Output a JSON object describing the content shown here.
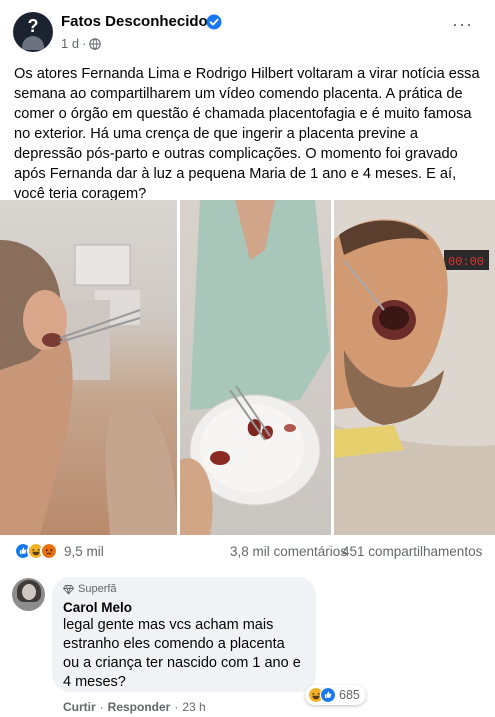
{
  "post": {
    "page_name": "Fatos Desconhecidos",
    "time": "1 d",
    "dot": "·",
    "more_label": "···",
    "caption": "Os atores Fernanda Lima e Rodrigo Hilbert voltaram a virar notícia essa semana ao compartilharem um vídeo comendo placenta. A prática de comer o órgão em questão é chamada placentofagia e é muito famosa no exterior. Há uma crença de que ingerir a placenta previne a depressão pós-parto e outras complicações. O momento foi gravado após Fernanda dar à luz a pequena Maria de 1 ano e 4 meses. E aí, você teria coragem?",
    "icons": {
      "verified": "verified-badge-icon",
      "audience": "globe-icon",
      "more": "more-options-icon"
    }
  },
  "stats": {
    "reactions_count": "9,5 mil",
    "comments": "3,8 mil comentários",
    "shares": "451 compartilhamentos",
    "reaction_types": [
      "like",
      "haha",
      "wow"
    ]
  },
  "comment": {
    "badge": "Superfã",
    "author": "Carol Melo",
    "text": "legal gente mas vcs acham mais estranho eles comendo a placenta ou a criança ter nascido com 1 ano e 4 meses?",
    "reaction_count": "685",
    "reaction_types": [
      "haha",
      "like"
    ],
    "like_label": "Curtir",
    "reply_label": "Responder",
    "sep": "·",
    "time": "23 h"
  },
  "colors": {
    "brand_blue": "#1877f2",
    "secondary_text": "#65676b",
    "haha_yellow": "#f7b125",
    "angry_orange": "#e9710f"
  }
}
